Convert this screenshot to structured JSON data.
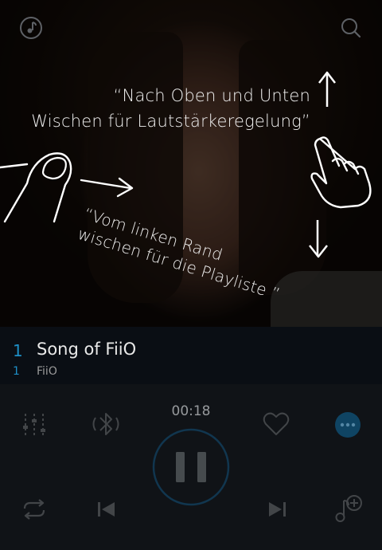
{
  "hints": {
    "volume_line1": "“Nach Oben und Unten",
    "volume_line2": "Wischen für Lautstärkeregelung”",
    "playlist_line1": "“Vom linken Rand",
    "playlist_line2": "wischen für die Playliste ”"
  },
  "track": {
    "number": "1",
    "sub_number": "1",
    "title": "Song of FiiO",
    "artist": "FiiO"
  },
  "player": {
    "time": "00:18",
    "state": "playing"
  },
  "icons": {
    "top_left": "music-note-icon",
    "top_right": "search-icon",
    "equalizer": "equalizer-icon",
    "bluetooth": "bluetooth-icon",
    "favorite": "heart-icon",
    "more": "more-icon",
    "pause": "pause-icon",
    "repeat": "repeat-icon",
    "previous": "previous-icon",
    "next": "next-icon",
    "add_to_playlist": "add-to-playlist-icon"
  },
  "colors": {
    "accent": "#1e8fc7"
  }
}
